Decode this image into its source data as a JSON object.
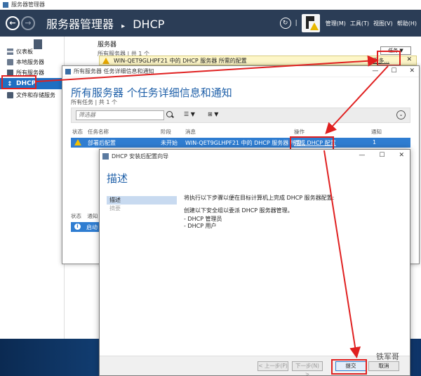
{
  "window": {
    "title": "服务器管理器"
  },
  "header": {
    "breadcrumb_root": "服务器管理器",
    "breadcrumb_sep": "▸",
    "breadcrumb_current": "DHCP",
    "separator": "|",
    "menu": [
      "管理(M)",
      "工具(T)",
      "视图(V)",
      "帮助(H)"
    ]
  },
  "sidebar": {
    "items": [
      {
        "label": "仪表板",
        "icon": "dashboard-icon"
      },
      {
        "label": "本地服务器",
        "icon": "server-icon"
      },
      {
        "label": "所有服务器",
        "icon": "all-servers-icon"
      },
      {
        "label": "DHCP",
        "icon": "dhcp-icon"
      },
      {
        "label": "文件和存储服务",
        "icon": "file-storage-icon"
      }
    ],
    "dhcp_glyph": "↕"
  },
  "main": {
    "servers_title": "服务器",
    "servers_sub": "所有服务器 | 共 1 个",
    "tasks_button": "任务 ▼",
    "notification": {
      "text": "WIN-QET9GLHPF21 中的 DHCP 服务器 所需的配置",
      "more": "更多...",
      "close": "✕"
    }
  },
  "details": {
    "window_title": "所有服务器 任务详细信息和通知",
    "heading": "所有服务器 个任务详细信息和通知",
    "sub": "所有任务 | 共 1 个",
    "filter_placeholder": "筛选器",
    "filter_list": "☰ ▼",
    "filter_group": "⊞ ▼",
    "collapse": "⌄",
    "columns": [
      "状态",
      "任务名称",
      "阶段",
      "消息",
      "操作",
      "通知"
    ],
    "row": {
      "task": "部署后配置",
      "stage": "未开始",
      "message": "WIN-QET9GLHPF21 中的 DHCP 服务器 所需...",
      "action": "完成 DHCP 配置",
      "notice": "1"
    },
    "lower_columns": [
      "状态",
      "通知"
    ],
    "lower_row": {
      "info": "i",
      "label": "启动"
    },
    "controls": {
      "minimize": "—",
      "maximize": "☐",
      "close": "✕"
    }
  },
  "wizard": {
    "title": "DHCP 安装后配置向导",
    "heading": "描述",
    "nav": [
      "描述",
      "摘要"
    ],
    "content": {
      "intro": "将执行以下步骤以便在目标计算机上完成 DHCP 服务器配置:",
      "groups_intro": "创建以下安全组以委派 DHCP 服务器管理。",
      "groups": [
        "- DHCP 管理员",
        "- DHCP 用户"
      ]
    },
    "buttons": {
      "prev": "< 上一步(P)",
      "next": "下一步(N) >",
      "submit": "提交",
      "cancel": "取消"
    },
    "controls": {
      "minimize": "—",
      "maximize": "☐",
      "close": "✕"
    },
    "watermark": "铁军哥"
  },
  "colors": {
    "accent": "#1f6fc2",
    "header_bg": "#2b3d56",
    "annotation": "#e02020",
    "warning": "#e8b800"
  }
}
